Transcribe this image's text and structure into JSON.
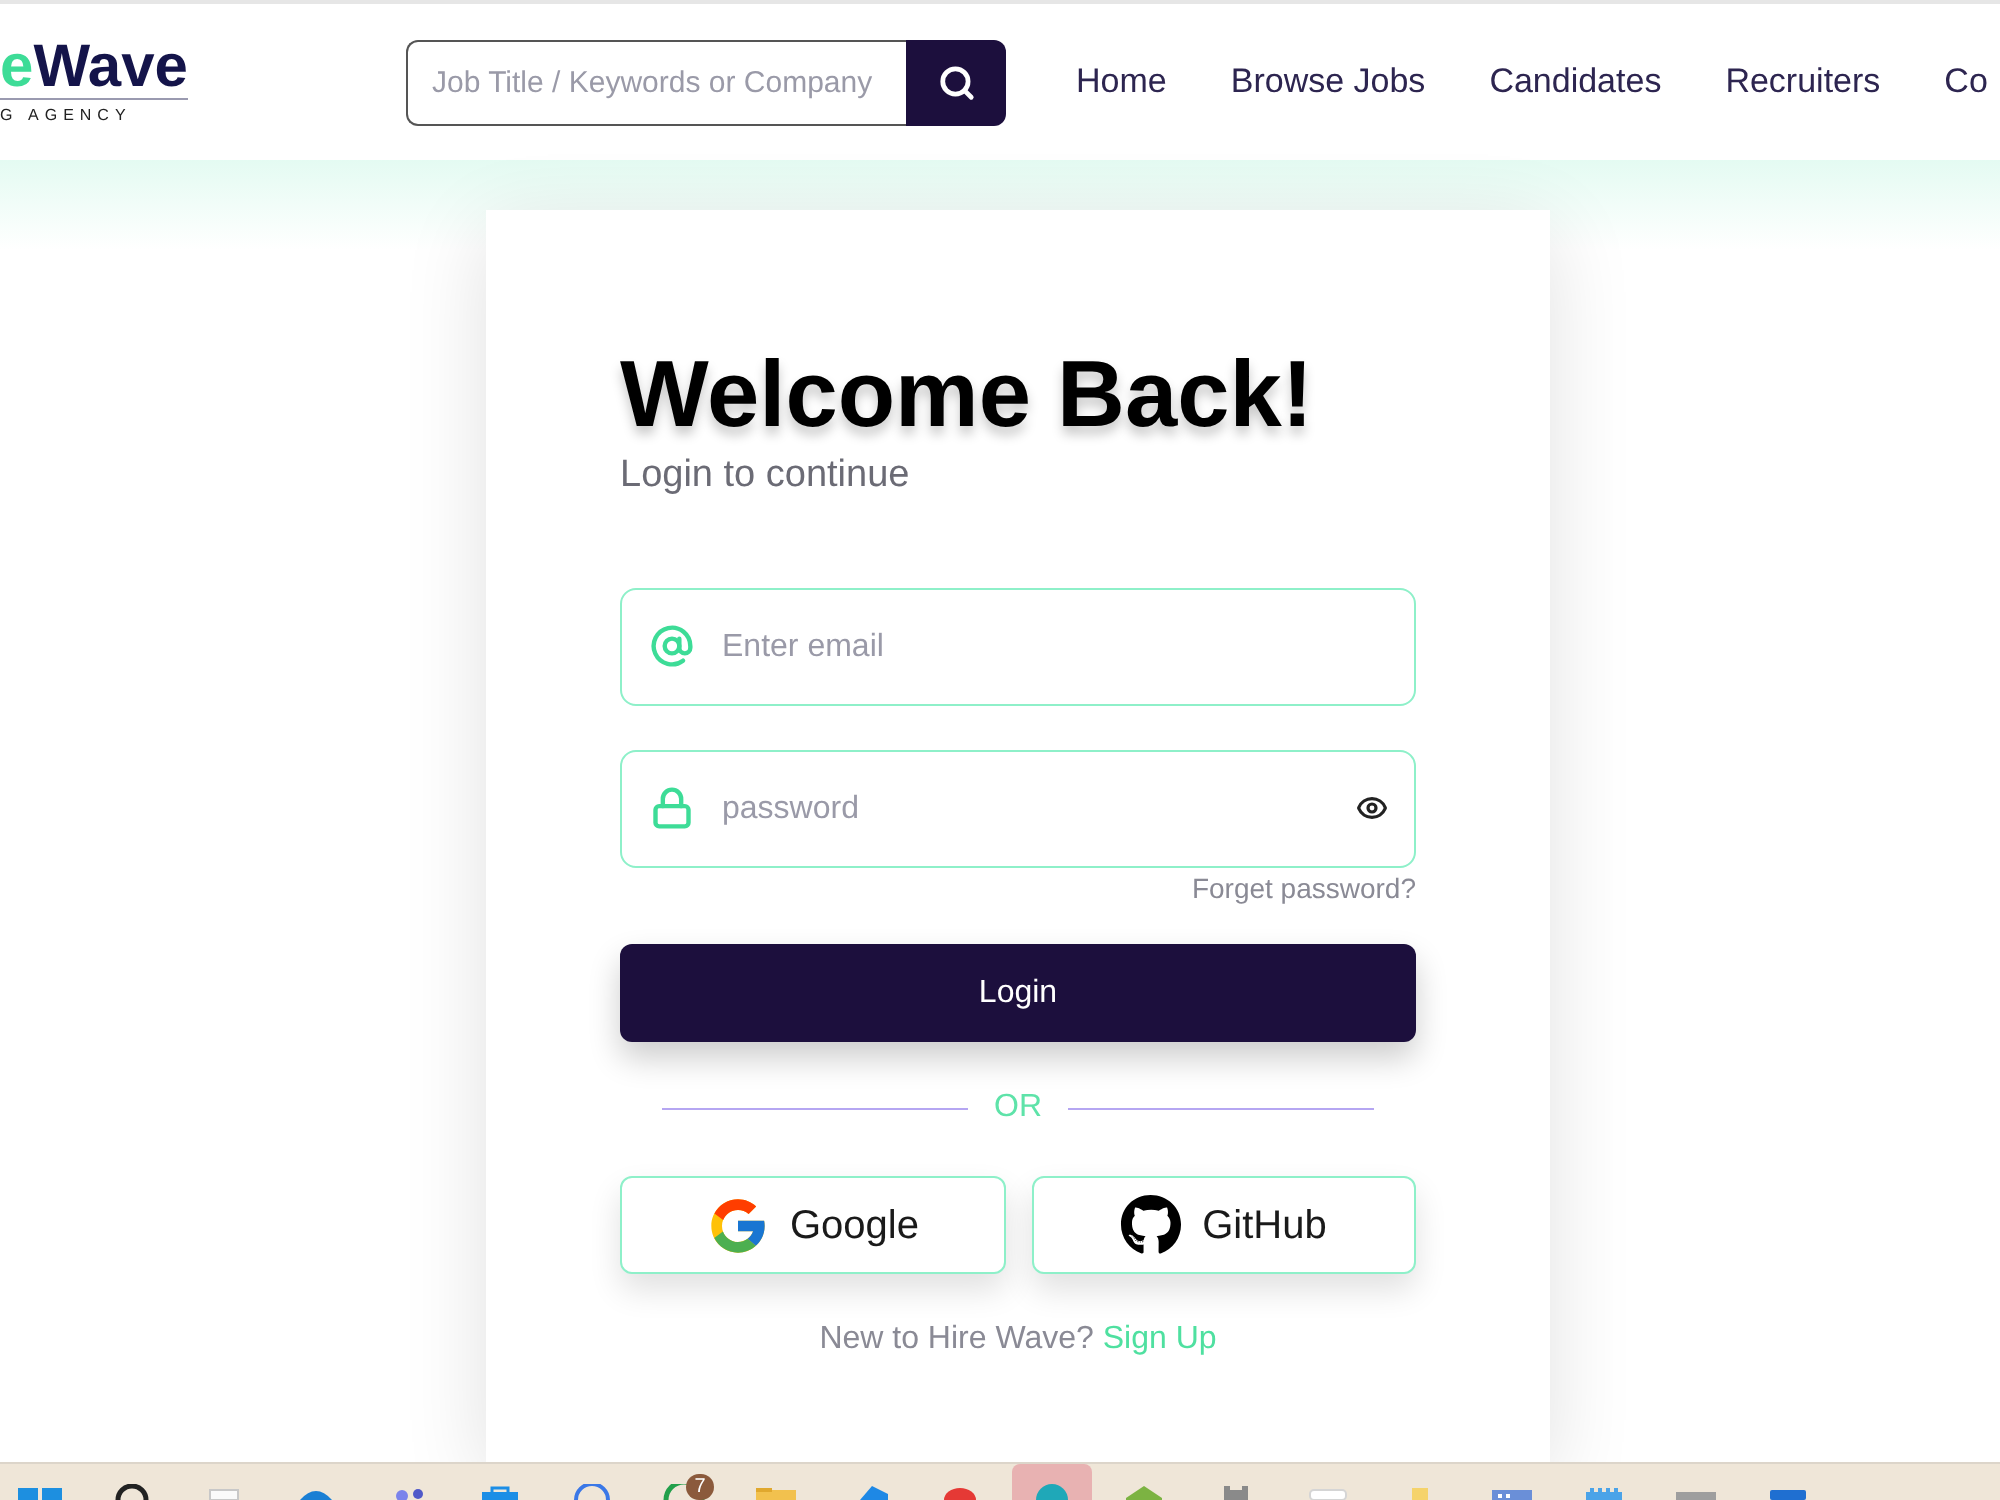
{
  "header": {
    "logo": {
      "accent": "e",
      "name": "Wave",
      "tagline": "G AGENCY"
    },
    "search": {
      "placeholder": "Job Title / Keywords or Company"
    },
    "nav": [
      {
        "label": "Home"
      },
      {
        "label": "Browse Jobs"
      },
      {
        "label": "Candidates"
      },
      {
        "label": "Recruiters"
      },
      {
        "label": "Co"
      }
    ]
  },
  "login": {
    "title": "Welcome Back!",
    "subtitle": "Login to continue",
    "fields": [
      {
        "kind": "email",
        "placeholder": "Enter email"
      },
      {
        "kind": "password",
        "placeholder": "password"
      }
    ],
    "forgot_link": "Forget password?",
    "submit": "Login",
    "divider": "OR",
    "social": [
      {
        "kind": "google",
        "label": "Google"
      },
      {
        "kind": "github",
        "label": "GitHub"
      }
    ],
    "signup": {
      "prompt": "New to Hire Wave?",
      "link": "Sign Up"
    }
  },
  "taskbar": {
    "apps": [
      {
        "kind": "windows",
        "selected": false
      },
      {
        "kind": "search",
        "selected": false
      },
      {
        "kind": "document",
        "selected": false
      },
      {
        "kind": "wave",
        "selected": false
      },
      {
        "kind": "people",
        "selected": false
      },
      {
        "kind": "bag",
        "selected": false
      },
      {
        "kind": "ring",
        "selected": false
      },
      {
        "kind": "green-ring",
        "badge": "7",
        "selected": false
      },
      {
        "kind": "folder",
        "selected": false
      },
      {
        "kind": "code",
        "selected": false
      },
      {
        "kind": "red",
        "selected": false
      },
      {
        "kind": "teal",
        "selected": true
      },
      {
        "kind": "house",
        "selected": false
      },
      {
        "kind": "gray",
        "selected": false
      },
      {
        "kind": "white",
        "selected": false
      },
      {
        "kind": "yellow",
        "selected": false
      },
      {
        "kind": "window",
        "selected": false
      },
      {
        "kind": "notepad",
        "selected": false
      },
      {
        "kind": "gray-box",
        "selected": false
      },
      {
        "kind": "blue",
        "selected": false
      }
    ]
  }
}
